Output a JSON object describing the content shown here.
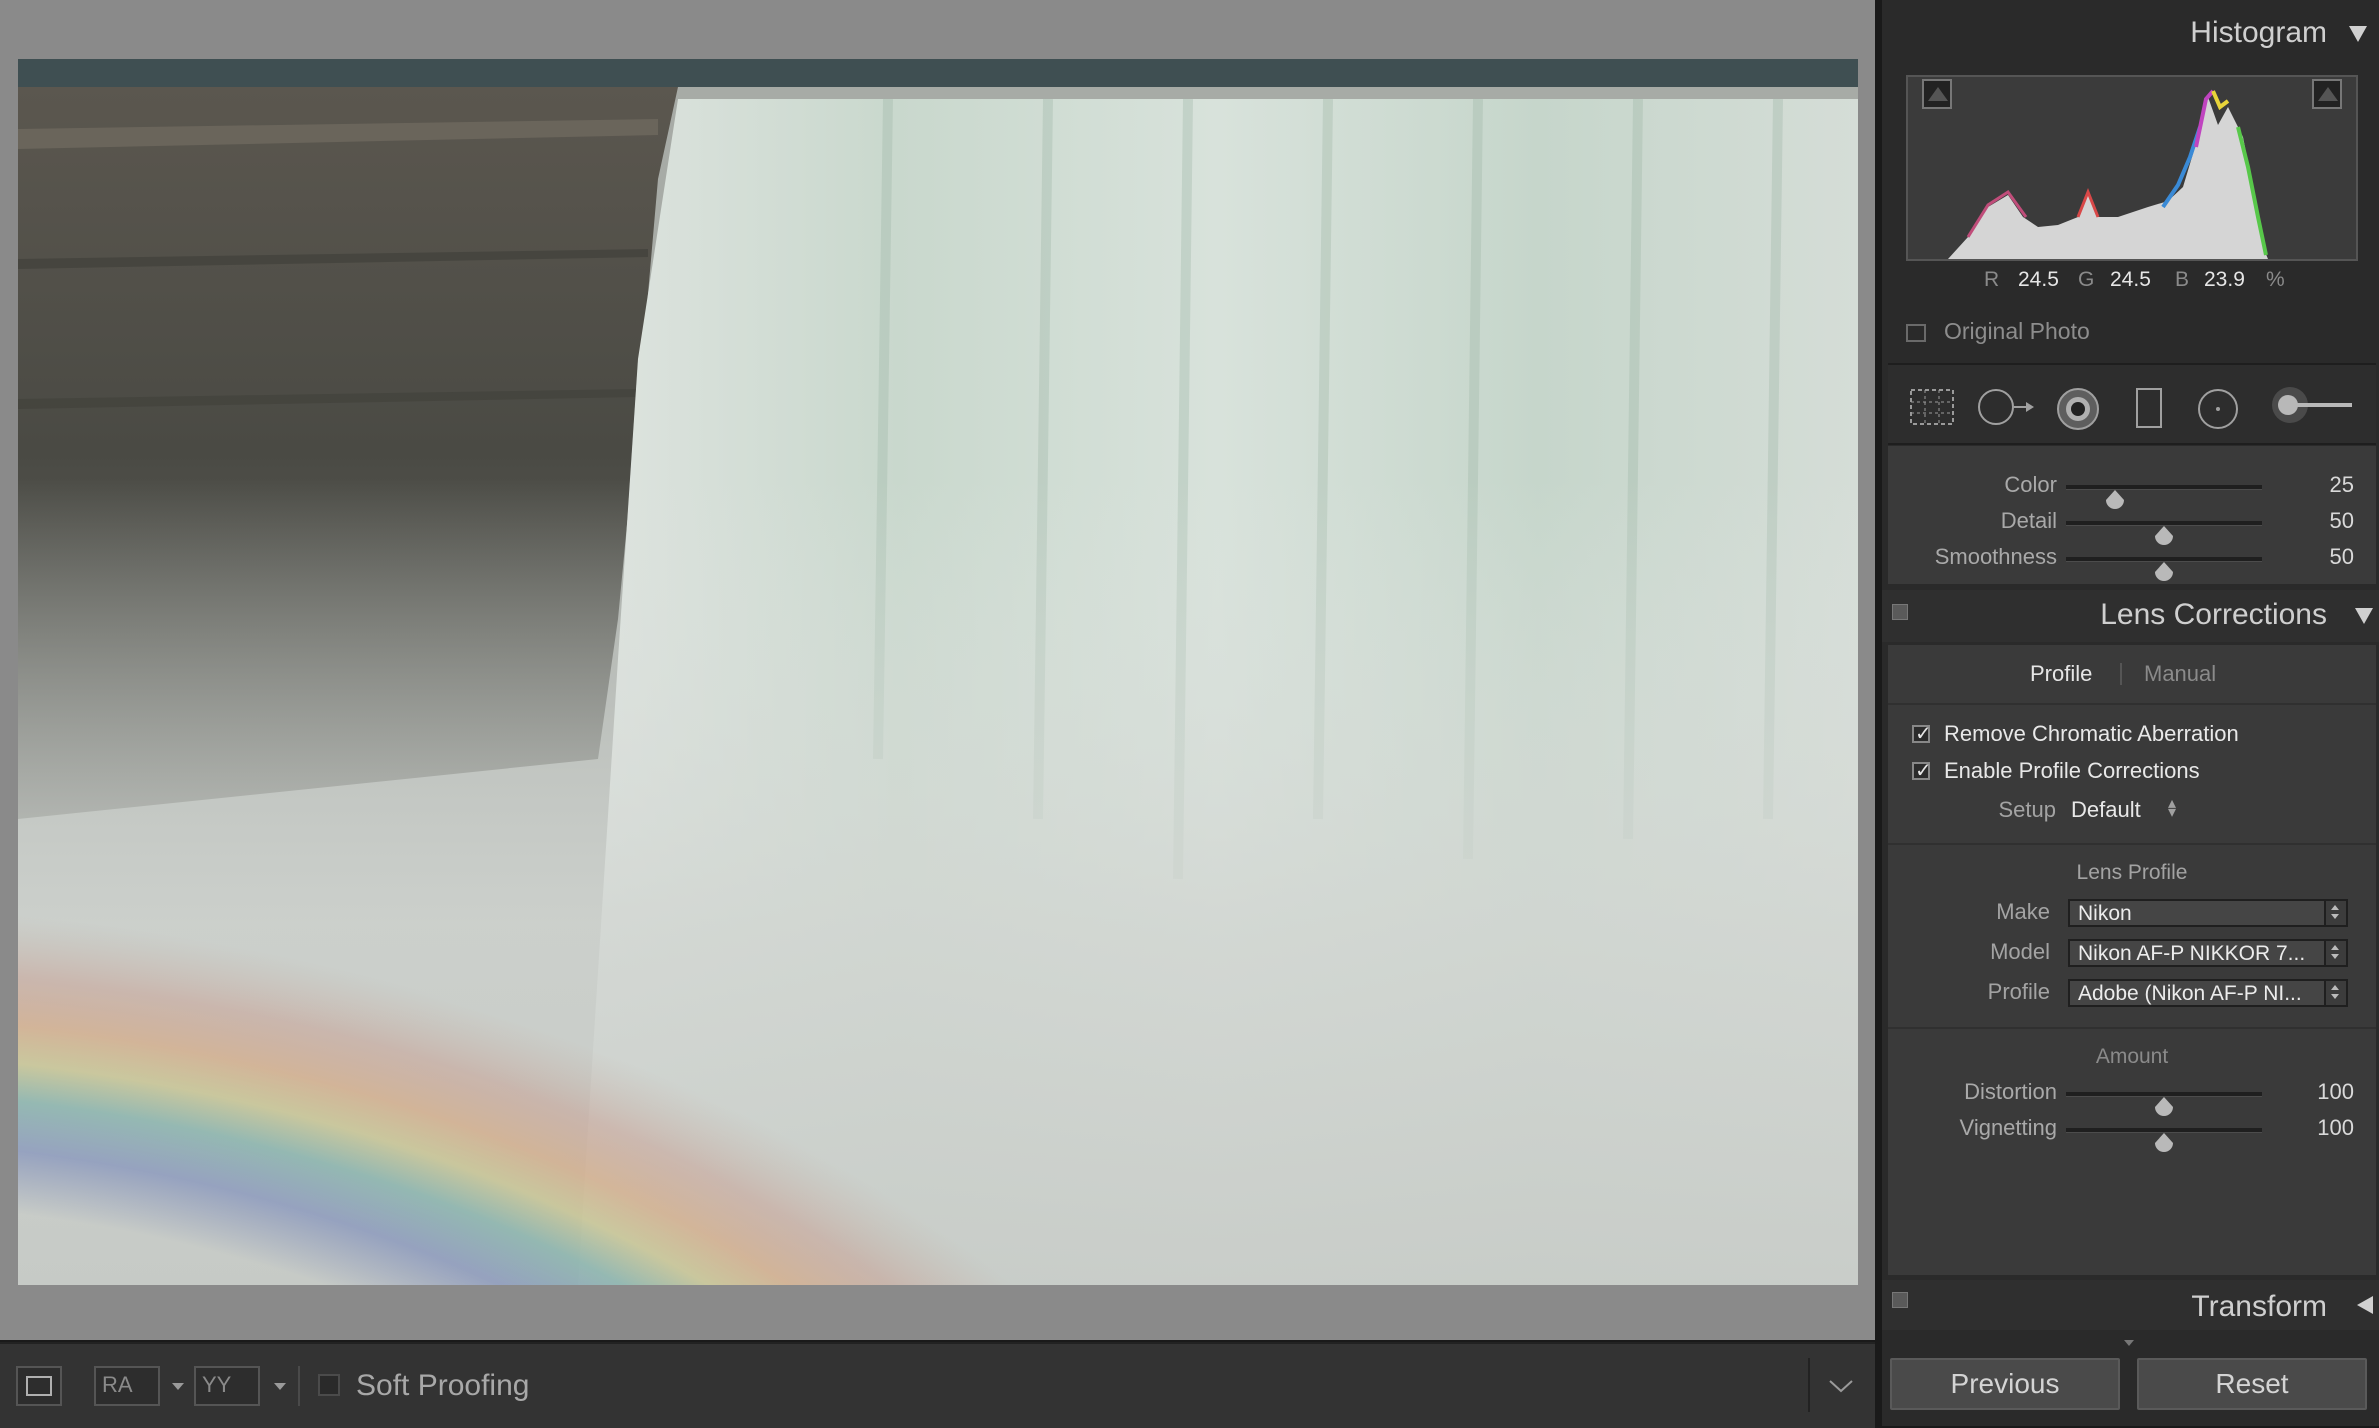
{
  "toolbar": {
    "compare_a_label": "RA",
    "compare_b_label": "YY",
    "soft_proofing_label": "Soft Proofing",
    "soft_proofing_checked": false
  },
  "histogram": {
    "title": "Histogram",
    "r_label": "R",
    "r_value": "24.5",
    "g_label": "G",
    "g_value": "24.5",
    "b_label": "B",
    "b_value": "23.9",
    "percent": "%",
    "original_photo_label": "Original Photo",
    "original_photo_checked": false
  },
  "tools": [
    "crop-overlay",
    "spot-removal",
    "red-eye",
    "graduated-filter",
    "radial-filter",
    "adjustment-brush"
  ],
  "noise_reduction": {
    "sliders": [
      {
        "label": "Color",
        "value": "25",
        "fraction": 0.25
      },
      {
        "label": "Detail",
        "value": "50",
        "fraction": 0.5
      },
      {
        "label": "Smoothness",
        "value": "50",
        "fraction": 0.5
      }
    ]
  },
  "lens_corrections": {
    "title": "Lens Corrections",
    "tab_profile": "Profile",
    "tab_manual": "Manual",
    "remove_ca_label": "Remove Chromatic Aberration",
    "remove_ca_checked": true,
    "enable_profile_label": "Enable Profile Corrections",
    "enable_profile_checked": true,
    "setup_label": "Setup",
    "setup_value": "Default",
    "lens_profile_heading": "Lens Profile",
    "make_label": "Make",
    "make_value": "Nikon",
    "model_label": "Model",
    "model_value": "Nikon AF-P NIKKOR 7...",
    "profile_label": "Profile",
    "profile_value": "Adobe (Nikon AF-P NI...",
    "amount_heading": "Amount",
    "distortion_label": "Distortion",
    "distortion_value": "100",
    "distortion_fraction": 0.5,
    "vignetting_label": "Vignetting",
    "vignetting_value": "100",
    "vignetting_fraction": 0.5
  },
  "transform": {
    "title": "Transform"
  },
  "buttons": {
    "previous": "Previous",
    "reset": "Reset"
  },
  "colors": {
    "panel_bg": "#3a3a3a",
    "viewer_bg": "#8a8a8a",
    "accent_text": "#e6e6e6"
  }
}
